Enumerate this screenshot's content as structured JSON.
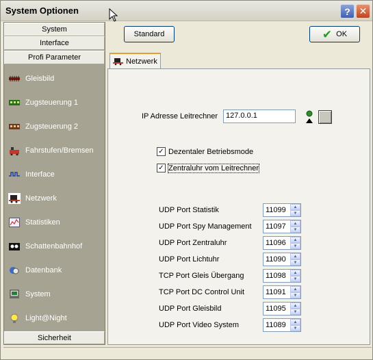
{
  "window": {
    "title": "System Optionen"
  },
  "nav": {
    "headers": [
      "System",
      "Interface",
      "Profi Parameter"
    ],
    "items": [
      {
        "label": "Gleisbild",
        "icon": "track-icon"
      },
      {
        "label": "Zugsteuerung 1",
        "icon": "train-control-icon"
      },
      {
        "label": "Zugsteuerung 2",
        "icon": "train-control-2-icon"
      },
      {
        "label": "Fahrstufen/Bremsen",
        "icon": "brake-icon"
      },
      {
        "label": "Interface",
        "icon": "interface-icon"
      },
      {
        "label": "Netzwerk",
        "icon": "network-icon"
      },
      {
        "label": "Statistiken",
        "icon": "stats-icon"
      },
      {
        "label": "Schattenbahnhof",
        "icon": "shadow-station-icon"
      },
      {
        "label": "Datenbank",
        "icon": "database-icon"
      },
      {
        "label": "System",
        "icon": "computer-icon"
      },
      {
        "label": "Light@Night",
        "icon": "lightbulb-icon"
      }
    ],
    "footer": "Sicherheit"
  },
  "toolbar": {
    "standard_label": "Standard",
    "ok_label": "OK"
  },
  "tab": {
    "label": "Netzwerk"
  },
  "network": {
    "ip_label": "IP Adresse Leitrechner",
    "ip_value": "127.0.0.1",
    "cb_dezentral": "Dezentaler Betriebsmode",
    "cb_zentraluhr": "Zentraluhr vom Leitrechner",
    "ports": [
      {
        "label": "UDP Port Statistik",
        "value": "11099"
      },
      {
        "label": "UDP Port Spy Management",
        "value": "11097"
      },
      {
        "label": "UDP Port Zentraluhr",
        "value": "11096"
      },
      {
        "label": "UDP Port Lichtuhr",
        "value": "11090"
      },
      {
        "label": "TCP Port Gleis Übergang",
        "value": "11098"
      },
      {
        "label": "TCP Port DC Control Unit",
        "value": "11091"
      },
      {
        "label": "UDP Port Gleisbild",
        "value": "11095"
      },
      {
        "label": "UDP Port Video System",
        "value": "11089"
      }
    ]
  }
}
